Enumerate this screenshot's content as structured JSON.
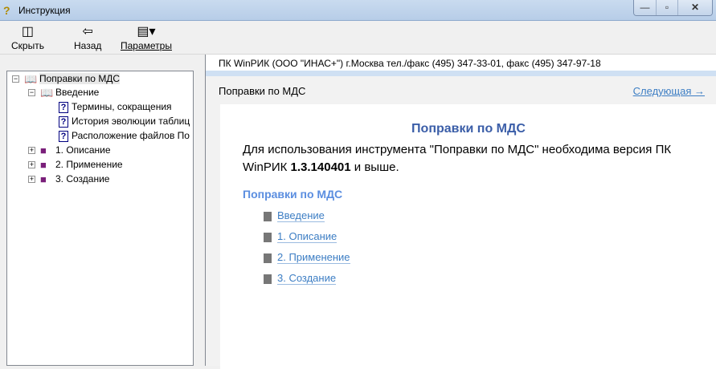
{
  "window": {
    "title": "Инструкция",
    "minimize": "—",
    "maximize": "▫",
    "close": "✕"
  },
  "toolbar": {
    "hide": "Скрыть",
    "back": "Назад",
    "options": "Параметры"
  },
  "tree": [
    {
      "label": "Поправки по МДС",
      "toggle": "−"
    },
    {
      "label": "Введение",
      "toggle": "−"
    },
    {
      "label": "Термины, сокращения"
    },
    {
      "label": "История эволюции таблиц"
    },
    {
      "label": "Расположение файлов По"
    },
    {
      "label": "1. Описание",
      "toggle": "+"
    },
    {
      "label": "2. Применение",
      "toggle": "+"
    },
    {
      "label": "3. Создание",
      "toggle": "+"
    }
  ],
  "content": {
    "header": "ПК WinРИК (ООО \"ИНАС+\") г.Москва тел./факс (495) 347-33-01, факс (495) 347-97-18",
    "nav_title": "Поправки по МДС",
    "next": "Следующая →",
    "title": "Поправки по МДС",
    "text_before": "Для использования инструмента \"Поправки по МДС\" необходима версия ПК WinРИК ",
    "version": "1.3.140401",
    "text_after": " и выше.",
    "section": "Поправки по МДС",
    "links": [
      "Введение",
      "1. Описание",
      "2. Применение",
      "3. Создание"
    ]
  }
}
